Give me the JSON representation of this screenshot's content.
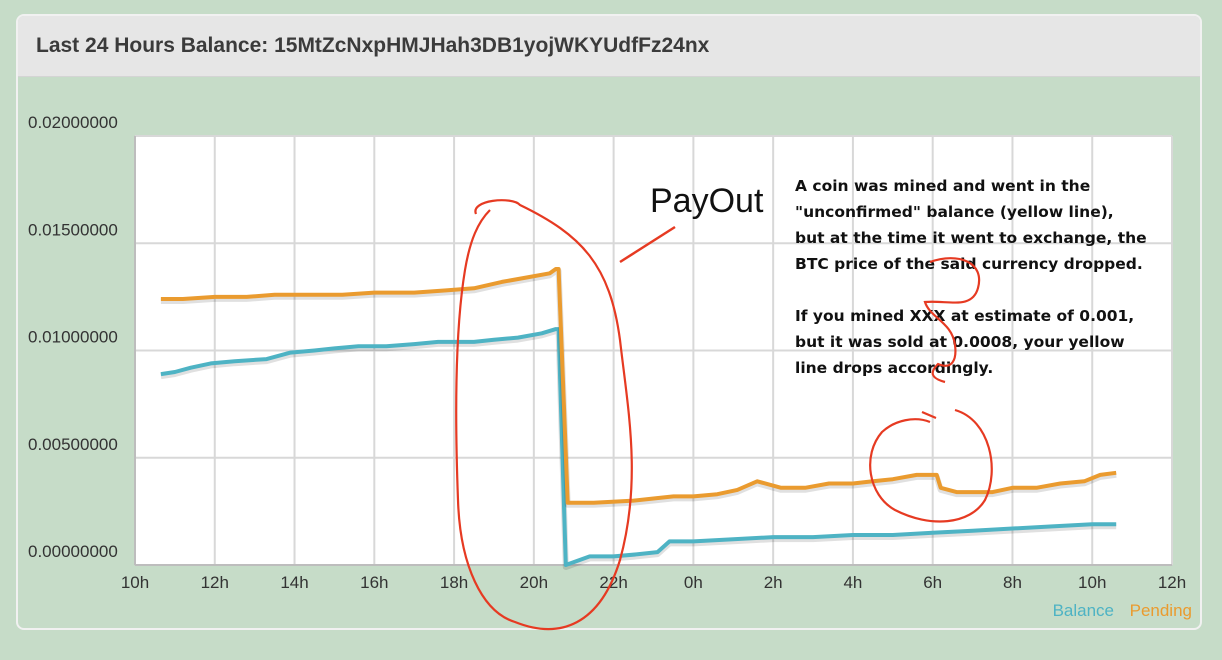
{
  "panel": {
    "title": "Last 24 Hours Balance: 15MtZcNxpHMJHah3DB1yojWKYUdfFz24nx"
  },
  "colors": {
    "balance": "#4eb3c4",
    "pending": "#ea9b2f",
    "annotation": "#e63a22",
    "grid": "#d8d8d8",
    "plot_bg": "#ffffff"
  },
  "chart_data": {
    "type": "line",
    "title": "",
    "xlabel": "",
    "ylabel": "",
    "x_tick_labels": [
      "10h",
      "12h",
      "14h",
      "16h",
      "18h",
      "20h",
      "22h",
      "0h",
      "2h",
      "4h",
      "6h",
      "8h",
      "10h",
      "12h"
    ],
    "y_tick_labels": [
      "0.00000000",
      "0.00500000",
      "0.01000000",
      "0.01500000",
      "0.02000000"
    ],
    "y_ticks": [
      0,
      0.005,
      0.01,
      0.015,
      0.02
    ],
    "xlim": [
      0,
      26
    ],
    "ylim": [
      0,
      0.02
    ],
    "grid": true,
    "legend": "bottom-right",
    "series": [
      {
        "name": "Balance",
        "color": "#4eb3c4",
        "x": [
          0.65,
          1.0,
          1.4,
          1.9,
          2.5,
          3.3,
          3.9,
          4.5,
          5.0,
          5.6,
          6.3,
          7.0,
          7.6,
          8.0,
          8.5,
          9.0,
          9.6,
          10.2,
          10.55,
          10.62,
          10.8,
          11.4,
          12.0,
          12.6,
          13.1,
          13.4,
          14.0,
          15.0,
          16.0,
          17.0,
          18.0,
          19.0,
          20.0,
          21.0,
          22.0,
          23.0,
          24.0,
          24.6
        ],
        "y": [
          0.0089,
          0.009,
          0.0092,
          0.0094,
          0.0095,
          0.0096,
          0.0099,
          0.01,
          0.0101,
          0.0102,
          0.0102,
          0.0103,
          0.0104,
          0.0104,
          0.0104,
          0.0105,
          0.0106,
          0.0108,
          0.011,
          0.011,
          0.0,
          0.0004,
          0.0004,
          0.0005,
          0.0006,
          0.0011,
          0.0011,
          0.0012,
          0.0013,
          0.0013,
          0.0014,
          0.0014,
          0.0015,
          0.0016,
          0.0017,
          0.0018,
          0.0019,
          0.0019
        ]
      },
      {
        "name": "Pending",
        "color": "#ea9b2f",
        "x": [
          0.65,
          1.2,
          2.0,
          2.8,
          3.5,
          4.3,
          5.2,
          6.0,
          7.0,
          7.8,
          8.5,
          9.2,
          9.8,
          10.4,
          10.55,
          10.62,
          10.85,
          11.5,
          12.5,
          13.0,
          13.5,
          14.0,
          14.6,
          15.1,
          15.6,
          16.2,
          16.8,
          17.4,
          18.0,
          18.5,
          19.0,
          19.6,
          20.1,
          20.2,
          20.6,
          21.0,
          21.5,
          22.0,
          22.6,
          23.2,
          23.8,
          24.2,
          24.6
        ],
        "y": [
          0.0124,
          0.0124,
          0.0125,
          0.0125,
          0.0126,
          0.0126,
          0.0126,
          0.0127,
          0.0127,
          0.0128,
          0.0129,
          0.0132,
          0.0134,
          0.0136,
          0.0138,
          0.0138,
          0.0029,
          0.0029,
          0.003,
          0.0031,
          0.0032,
          0.0032,
          0.0033,
          0.0035,
          0.0039,
          0.0036,
          0.0036,
          0.0038,
          0.0038,
          0.0039,
          0.004,
          0.0042,
          0.0042,
          0.0036,
          0.0034,
          0.0034,
          0.0034,
          0.0036,
          0.0036,
          0.0038,
          0.0039,
          0.0042,
          0.0043
        ]
      }
    ],
    "annotations": [
      {
        "text": "PayOut"
      },
      {
        "lines": [
          "A coin was mined and went in the",
          "\"unconfirmed\" balance (yellow line),",
          "but at the time it went to exchange, the",
          "BTC price of the said currency dropped.",
          "",
          "If you mined XXX at estimate of 0.001,",
          "but it was sold at 0.0008, your yellow",
          "line drops accordingly."
        ]
      }
    ]
  }
}
